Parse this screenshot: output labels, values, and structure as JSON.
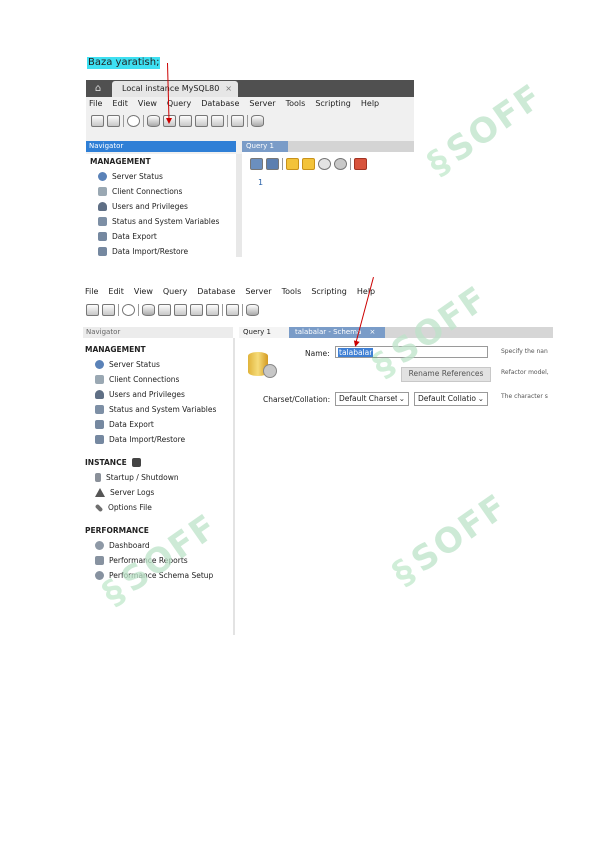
{
  "heading": "Baza yaratish;",
  "screenshot1": {
    "tab_label": "Local instance MySQL80",
    "tab_close": "×",
    "menu": [
      "File",
      "Edit",
      "View",
      "Query",
      "Database",
      "Server",
      "Tools",
      "Scripting",
      "Help"
    ],
    "navigator_label": "Navigator",
    "query_tab": "Query 1",
    "query_tab_close": "×",
    "line_number": "1",
    "management_label": "MANAGEMENT",
    "management_items": [
      "Server Status",
      "Client Connections",
      "Users and Privileges",
      "Status and System Variables",
      "Data Export",
      "Data Import/Restore"
    ]
  },
  "screenshot2": {
    "menu": [
      "File",
      "Edit",
      "View",
      "Query",
      "Database",
      "Server",
      "Tools",
      "Scripting",
      "Help"
    ],
    "navigator_label": "Navigator",
    "query_tab": "Query 1",
    "schema_tab": "talabalar - Schema",
    "schema_tab_close": "×",
    "management_label": "MANAGEMENT",
    "management_items": [
      "Server Status",
      "Client Connections",
      "Users and Privileges",
      "Status and System Variables",
      "Data Export",
      "Data Import/Restore"
    ],
    "instance_label": "INSTANCE",
    "instance_items": [
      "Startup / Shutdown",
      "Server Logs",
      "Options File"
    ],
    "performance_label": "PERFORMANCE",
    "performance_items": [
      "Dashboard",
      "Performance Reports",
      "Performance Schema Setup"
    ],
    "name_label": "Name:",
    "name_value": "talabalar",
    "name_hint": "Specify the nan",
    "rename_button": "Rename References",
    "rename_hint": "Refactor model,",
    "charset_label": "Charset/Collation:",
    "charset_value": "Default Charset",
    "collation_value": "Default Collatior",
    "charset_hint": "The character s"
  },
  "watermark": "SOFF",
  "colors": {
    "heading_highlight": "#3ee0f2",
    "navigator_active": "#2f7fd6",
    "tabbar": "#505050",
    "annotation_arrow": "#cc0000",
    "selection": "#3e7fd4"
  }
}
